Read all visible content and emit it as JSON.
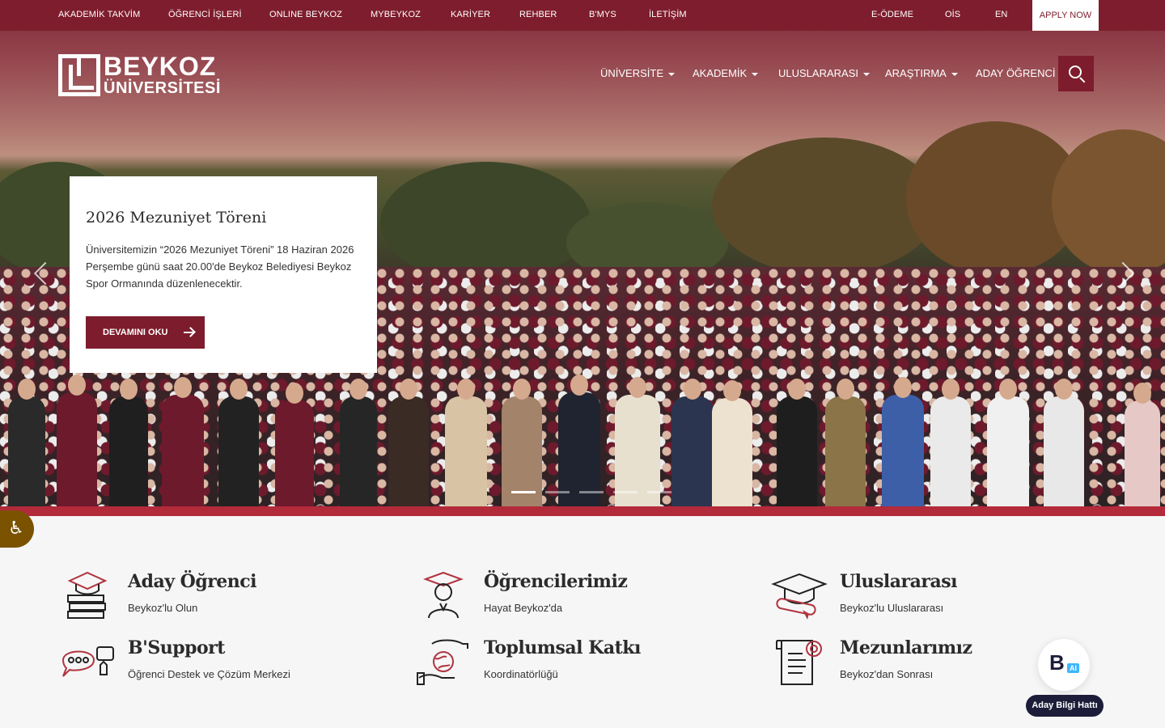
{
  "topbar": {
    "links": [
      "AKADEMİK TAKVİM",
      "ÖĞRENCİ İŞLERİ",
      "ONLINE BEYKOZ",
      "MYBEYKOZ",
      "KARİYER",
      "REHBER",
      "B'MYS",
      "İLETİŞİM"
    ],
    "right_links": [
      "E-ÖDEME",
      "OİS",
      "EN"
    ],
    "apply_label": "APPLY NOW"
  },
  "logo": {
    "line1": "BEYKOZ",
    "line2": "ÜNİVERSİTESİ"
  },
  "nav": {
    "items": [
      {
        "label": "ÜNİVERSİTE",
        "dropdown": true
      },
      {
        "label": "AKADEMİK",
        "dropdown": true
      },
      {
        "label": "ULUSLARARASI",
        "dropdown": true
      },
      {
        "label": "ARAŞTIRMA",
        "dropdown": true
      },
      {
        "label": "ADAY ÖĞRENCİ",
        "dropdown": false
      }
    ],
    "search_icon": "search-icon"
  },
  "hero": {
    "title": "2026 Mezuniyet Töreni",
    "text": "Üniversitemizin “2026 Mezuniyet Töreni” 18 Haziran 2026 Perşembe günü saat 20.00'de Beykoz Belediyesi Beykoz Spor Ormanında düzenlenecektir.",
    "button_label": "DEVAMINI OKU",
    "slide_count": 5,
    "active_slide": 1
  },
  "quick_links": [
    {
      "title": "Aday Öğrenci",
      "subtitle": "Beykoz'lu Olun",
      "icon": "graduation-books-icon"
    },
    {
      "title": "Öğrencilerimiz",
      "subtitle": "Hayat Beykoz'da",
      "icon": "student-icon"
    },
    {
      "title": "Uluslararası",
      "subtitle": "Beykoz'lu Uluslararası",
      "icon": "cap-diploma-icon"
    },
    {
      "title": "B'Support",
      "subtitle": "Öğrenci Destek ve Çözüm Merkezi",
      "icon": "support-chat-icon"
    },
    {
      "title": "Toplumsal Katkı",
      "subtitle": "Koordinatörlüğü",
      "icon": "hand-globe-icon"
    },
    {
      "title": "Mezunlarımız",
      "subtitle": "Beykoz'dan Sonrası",
      "icon": "certificate-icon"
    }
  ],
  "chatbot": {
    "badge": "AI",
    "logo_letter": "B",
    "label": "Aday Bilgi Hattı"
  },
  "colors": {
    "brand": "#7d1c2c",
    "accent_icon": "#b0343f",
    "accessibility": "#7a5200"
  }
}
